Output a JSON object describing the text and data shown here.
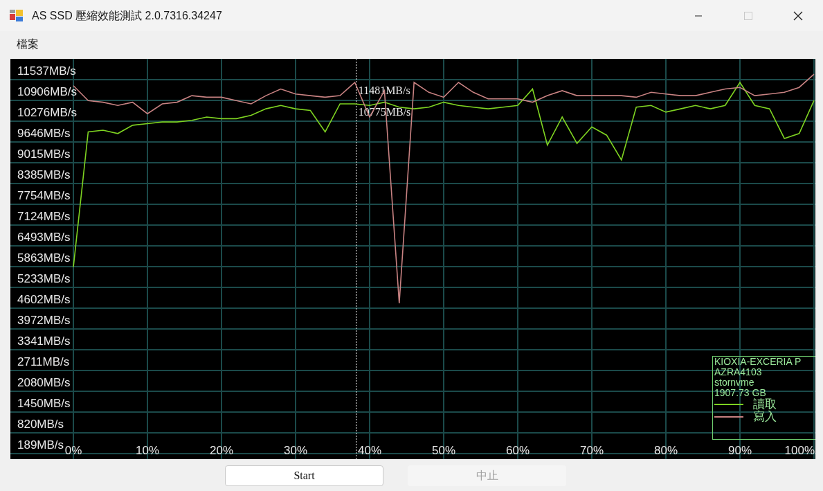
{
  "window": {
    "title": "AS SSD 壓縮效能測試 2.0.7316.34247",
    "controls": [
      {
        "kind": "minimize",
        "disabled": false
      },
      {
        "kind": "maximize",
        "disabled": true
      },
      {
        "kind": "close",
        "disabled": false
      }
    ]
  },
  "menu": [
    "檔案"
  ],
  "chart": {
    "chart_data": {
      "type": "line",
      "x": [
        0,
        2,
        4,
        6,
        8,
        10,
        12,
        14,
        16,
        18,
        20,
        22,
        24,
        26,
        28,
        30,
        32,
        34,
        36,
        38,
        40,
        42,
        44,
        46,
        48,
        50,
        52,
        54,
        56,
        58,
        60,
        62,
        64,
        66,
        68,
        70,
        72,
        74,
        76,
        78,
        80,
        82,
        84,
        86,
        88,
        90,
        92,
        94,
        96,
        98,
        100
      ],
      "series": [
        {
          "name": "讀取",
          "color": "#7ed321",
          "values": [
            5850,
            9950,
            10000,
            9900,
            10150,
            10200,
            10250,
            10250,
            10300,
            10400,
            10350,
            10350,
            10450,
            10650,
            10750,
            10650,
            10600,
            9950,
            10800,
            10800,
            10750,
            10850,
            10700,
            10650,
            10700,
            10850,
            10750,
            10700,
            10650,
            10700,
            10750,
            11250,
            9550,
            10400,
            9600,
            10100,
            9850,
            9100,
            10700,
            10750,
            10550,
            10650,
            10750,
            10650,
            10750,
            11450,
            10750,
            10650,
            9750,
            9900,
            10900
          ]
        },
        {
          "name": "寫入",
          "color": "#c88282",
          "values": [
            11350,
            10900,
            10850,
            10750,
            10850,
            10500,
            10800,
            10850,
            11050,
            11000,
            11000,
            10900,
            10800,
            11050,
            11250,
            11100,
            11050,
            11000,
            11050,
            11450,
            10400,
            11200,
            4750,
            11450,
            11150,
            11000,
            11450,
            11150,
            10950,
            10950,
            10950,
            10850,
            11050,
            11200,
            11050,
            11050,
            11050,
            11050,
            11000,
            11150,
            11100,
            11050,
            11050,
            11150,
            11250,
            11300,
            11050,
            11100,
            11150,
            11300,
            11700
          ]
        }
      ],
      "xlim": [
        0,
        100
      ],
      "ylim": [
        21,
        12165
      ],
      "xticks": [
        {
          "value": 0,
          "label": "0%"
        },
        {
          "value": 10,
          "label": "10%"
        },
        {
          "value": 20,
          "label": "20%"
        },
        {
          "value": 30,
          "label": "30%"
        },
        {
          "value": 40,
          "label": "40%"
        },
        {
          "value": 50,
          "label": "50%"
        },
        {
          "value": 60,
          "label": "60%"
        },
        {
          "value": 70,
          "label": "70%"
        },
        {
          "value": 80,
          "label": "80%"
        },
        {
          "value": 90,
          "label": "90%"
        },
        {
          "value": 100,
          "label": "100%"
        }
      ],
      "yticks": [
        {
          "value": 11537,
          "label": "11537MB/s"
        },
        {
          "value": 10906,
          "label": "10906MB/s"
        },
        {
          "value": 10276,
          "label": "10276MB/s"
        },
        {
          "value": 9646,
          "label": "9646MB/s"
        },
        {
          "value": 9015,
          "label": "9015MB/s"
        },
        {
          "value": 8385,
          "label": "8385MB/s"
        },
        {
          "value": 7754,
          "label": "7754MB/s"
        },
        {
          "value": 7124,
          "label": "7124MB/s"
        },
        {
          "value": 6493,
          "label": "6493MB/s"
        },
        {
          "value": 5863,
          "label": "5863MB/s"
        },
        {
          "value": 5233,
          "label": "5233MB/s"
        },
        {
          "value": 4602,
          "label": "4602MB/s"
        },
        {
          "value": 3972,
          "label": "3972MB/s"
        },
        {
          "value": 3341,
          "label": "3341MB/s"
        },
        {
          "value": 2711,
          "label": "2711MB/s"
        },
        {
          "value": 2080,
          "label": "2080MB/s"
        },
        {
          "value": 1450,
          "label": "1450MB/s"
        },
        {
          "value": 820,
          "label": "820MB/s"
        },
        {
          "value": 189,
          "label": "189MB/s"
        }
      ],
      "annotations": [
        "11481MB/s",
        "10775MB/s"
      ],
      "ref_lines": [
        {
          "axis": "x",
          "value": 38.2,
          "color": "#ffffff"
        }
      ],
      "grid": true,
      "legend": true
    },
    "legend": {
      "device": [
        "KIOXIA-EXCERIA P",
        "AZRA4103",
        "stornvme",
        "1907.73 GB"
      ]
    }
  },
  "buttons": [
    {
      "label": "Start",
      "disabled": false
    },
    {
      "label": "中止",
      "disabled": true
    }
  ]
}
